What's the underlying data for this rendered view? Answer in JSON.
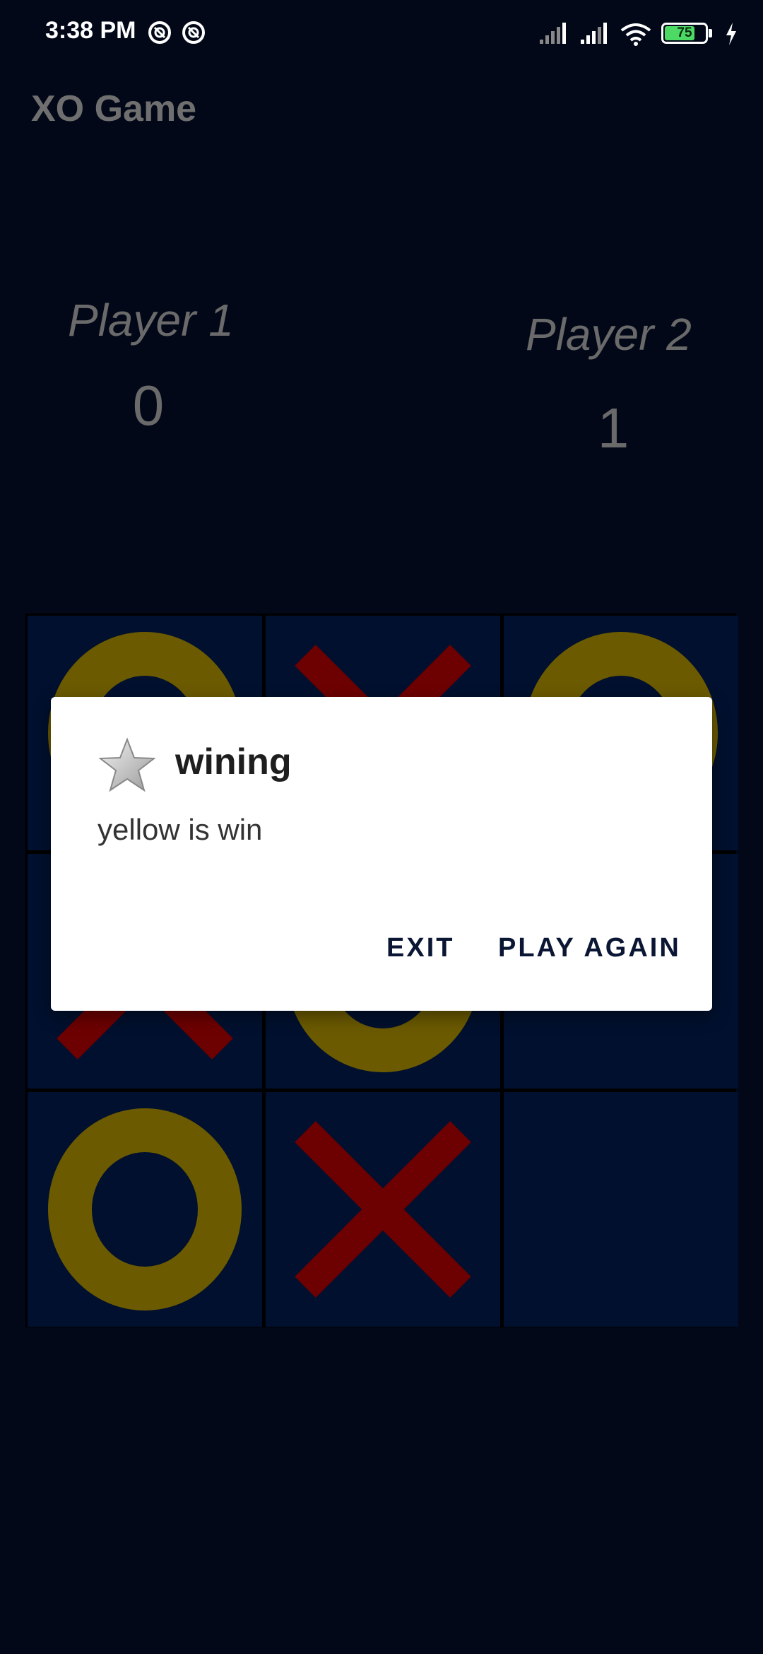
{
  "status_bar": {
    "time": "3:38 PM",
    "battery_level": "75",
    "battery_fraction": 0.75,
    "icons": [
      "at-icon",
      "at-icon",
      "signal-icon",
      "signal-icon",
      "wifi-icon",
      "battery-icon",
      "charging-icon"
    ]
  },
  "app": {
    "title": "XO Game"
  },
  "players": [
    {
      "name": "Player 1",
      "score": "0"
    },
    {
      "name": "Player 2",
      "score": "1"
    }
  ],
  "board": {
    "cells": [
      "O",
      "X",
      "O",
      "X",
      "O",
      "",
      "O",
      "X",
      ""
    ],
    "colors": {
      "O": "#6b5a00",
      "X": "#6d0000",
      "cell": "#00102e"
    }
  },
  "dialog": {
    "icon": "star-icon",
    "title": "wining",
    "message": "yellow is win",
    "buttons": {
      "exit": "EXIT",
      "play_again": "PLAY AGAIN"
    }
  }
}
